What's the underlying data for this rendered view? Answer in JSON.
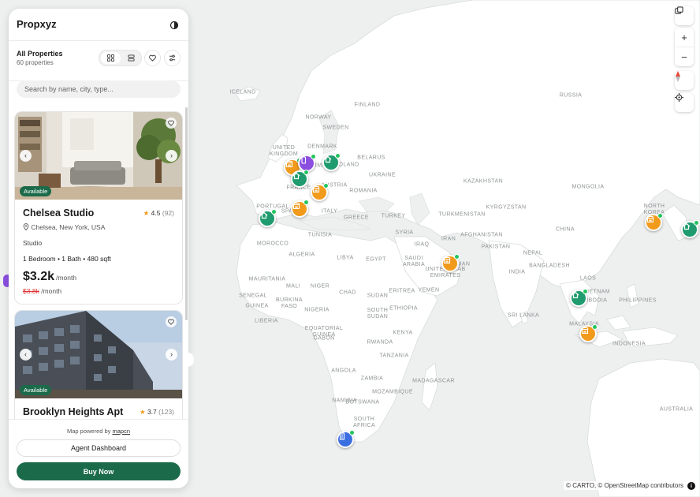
{
  "app": {
    "brand": "Propxyz"
  },
  "header": {
    "title": "All Properties",
    "count": "60 properties"
  },
  "search": {
    "placeholder": "Search by name, city, type..."
  },
  "listings": [
    {
      "name": "Chelsea Studio",
      "rating": "4.5",
      "reviews": "(92)",
      "location": "Chelsea, New York, USA",
      "type": "Studio",
      "specs": "1 Bedroom • 1 Bath • 480 sqft",
      "price": "$3.2k",
      "per": "/month",
      "old_price": "$3.8k",
      "old_per": "/month",
      "badge": "Available"
    },
    {
      "name": "Brooklyn Heights Apt",
      "rating": "3.7",
      "reviews": "(123)",
      "badge": "Available"
    }
  ],
  "footer": {
    "powered": "Map powered by",
    "powered_link": "mapcn",
    "agent_button": "Agent Dashboard",
    "buy_button": "Buy Now"
  },
  "map": {
    "labels": [
      "RUSSIA",
      "FINLAND",
      "SWEDEN",
      "NORWAY",
      "ICELAND",
      "UNITED KINGDOM",
      "DENMARK",
      "BELARUS",
      "UKRAINE",
      "POLAND",
      "GERMANY",
      "FRANCE",
      "AUSTRIA",
      "ROMANIA",
      "KAZAKHSTAN",
      "MONGOLIA",
      "KYRGYZSTAN",
      "TURKMENISTAN",
      "TURKEY",
      "GREECE",
      "CHINA",
      "NORTH KOREA",
      "SYRIA",
      "IRAQ",
      "IRAN",
      "AFGHANISTAN",
      "PAKISTAN",
      "NEPAL",
      "INDIA",
      "BANGLADESH",
      "LAOS",
      "VIETNAM",
      "CAMBODIA",
      "PHILIPPINES",
      "MALAYSIA",
      "INDONESIA",
      "TUNISIA",
      "MOROCCO",
      "ALGERIA",
      "LIBYA",
      "EGYPT",
      "SAUDI ARABIA",
      "UNITED ARAB EMIRATES",
      "YEMEN",
      "OMAN",
      "MAURITANIA",
      "MALI",
      "NIGER",
      "CHAD",
      "SUDAN",
      "ERITREA",
      "ETHIOPIA",
      "SOUTH SUDAN",
      "SENEGAL",
      "GUINEA",
      "BURKINA FASO",
      "NIGERIA",
      "LIBERIA",
      "EQUATORIAL GUINEA",
      "GABON",
      "KENYA",
      "RWANDA",
      "TANZANIA",
      "ANGOLA",
      "ZAMBIA",
      "MOZAMBIQUE",
      "NAMIBIA",
      "BOTSWANA",
      "SOUTH AFRICA",
      "MADAGASCAR",
      "SRI LANKA",
      "AUSTRALIA",
      "PORTUGAL",
      "SPAIN",
      "ITALY"
    ],
    "attribution": "© CARTO, © OpenStreetMap contributors",
    "colors": {
      "green": "#1f9b6e",
      "orange": "#f29a1b",
      "purple": "#8b4fe0",
      "blue": "#3b6fe0",
      "accent": "#1b6b4a"
    }
  }
}
